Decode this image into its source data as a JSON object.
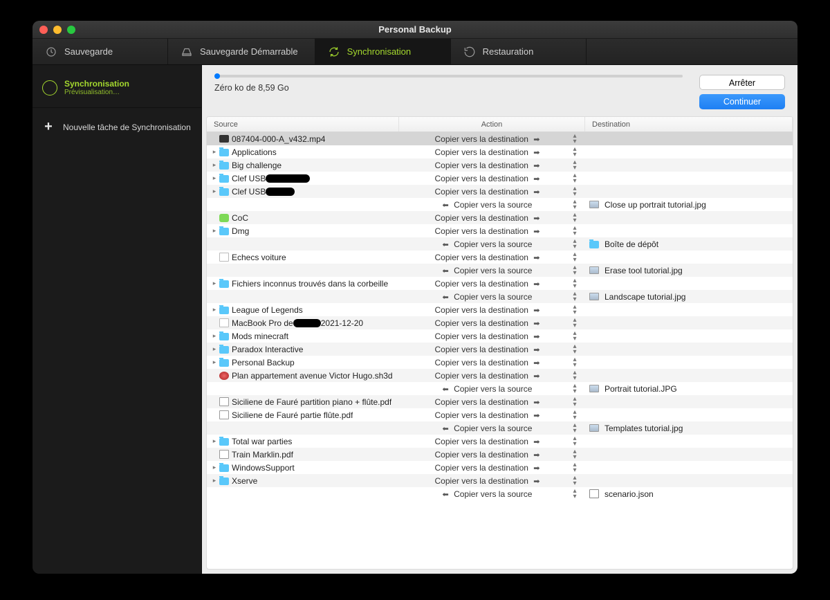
{
  "window_title": "Personal Backup",
  "tabs": [
    {
      "label": "Sauvegarde",
      "icon": "sync"
    },
    {
      "label": "Sauvegarde Démarrable",
      "icon": "drive"
    },
    {
      "label": "Synchronisation",
      "icon": "refresh",
      "active": true
    },
    {
      "label": "Restauration",
      "icon": "restore"
    }
  ],
  "sidebar": {
    "task_title": "Synchronisation",
    "task_sub": "Prévisualisation…",
    "new_task": "Nouvelle tâche de Synchronisation"
  },
  "progress_text": "Zéro ko de 8,59 Go",
  "buttons": {
    "stop": "Arrêter",
    "continue": "Continuer"
  },
  "columns": {
    "source": "Source",
    "action": "Action",
    "destination": "Destination"
  },
  "actions": {
    "to_dest": "Copier vers la destination",
    "to_src": "Copier vers la source"
  },
  "rows": [
    {
      "sel": true,
      "src": "087404-000-A_v432.mp4",
      "icon": "video",
      "exp": false,
      "dir": "dest"
    },
    {
      "src": "Applications",
      "icon": "folder",
      "exp": true,
      "dir": "dest"
    },
    {
      "src": "Big challenge",
      "icon": "folder",
      "exp": true,
      "dir": "dest"
    },
    {
      "src": "Clef USB",
      "icon": "folder",
      "exp": true,
      "dir": "dest",
      "redact": 64
    },
    {
      "src": "Clef USB",
      "icon": "folder",
      "exp": true,
      "dir": "dest",
      "redact": 42
    },
    {
      "dir": "src",
      "dst": "Close up portrait tutorial.jpg",
      "dsticon": "img"
    },
    {
      "src": "CoC",
      "icon": "app",
      "exp": false,
      "dir": "dest"
    },
    {
      "src": "Dmg",
      "icon": "folder",
      "exp": true,
      "dir": "dest"
    },
    {
      "dir": "src",
      "dst": "Boîte de dépôt",
      "dsticon": "folder"
    },
    {
      "src": "Echecs voiture",
      "icon": "file",
      "exp": false,
      "dir": "dest"
    },
    {
      "dir": "src",
      "dst": "Erase tool tutorial.jpg",
      "dsticon": "img"
    },
    {
      "src": "Fichiers inconnus trouvés dans la corbeille",
      "icon": "folder",
      "exp": true,
      "dir": "dest"
    },
    {
      "dir": "src",
      "dst": "Landscape tutorial.jpg",
      "dsticon": "img"
    },
    {
      "src": "League of Legends",
      "icon": "folder",
      "exp": true,
      "dir": "dest"
    },
    {
      "src": "MacBook Pro de",
      "src_suffix": "2021-12-20",
      "icon": "file",
      "exp": false,
      "dir": "dest",
      "redact": 40
    },
    {
      "src": "Mods minecraft",
      "icon": "folder",
      "exp": true,
      "dir": "dest"
    },
    {
      "src": "Paradox Interactive",
      "icon": "folder",
      "exp": true,
      "dir": "dest"
    },
    {
      "src": "Personal Backup",
      "icon": "folder",
      "exp": true,
      "dir": "dest"
    },
    {
      "src": "Plan appartement avenue Victor Hugo.sh3d",
      "icon": "sh3d",
      "exp": false,
      "dir": "dest"
    },
    {
      "dir": "src",
      "dst": "Portrait tutorial.JPG",
      "dsticon": "img"
    },
    {
      "src": "Siciliene de Fauré partition piano + flûte.pdf",
      "icon": "pdf",
      "exp": false,
      "dir": "dest"
    },
    {
      "src": "Siciliene de Fauré partie flûte.pdf",
      "icon": "pdf",
      "exp": false,
      "dir": "dest"
    },
    {
      "dir": "src",
      "dst": "Templates tutorial.jpg",
      "dsticon": "img"
    },
    {
      "src": "Total war parties",
      "icon": "folder",
      "exp": true,
      "dir": "dest"
    },
    {
      "src": "Train Marklin.pdf",
      "icon": "pdf",
      "exp": false,
      "dir": "dest"
    },
    {
      "src": "WindowsSupport",
      "icon": "folder",
      "exp": true,
      "dir": "dest"
    },
    {
      "src": "Xserve",
      "icon": "folder",
      "exp": true,
      "dir": "dest"
    },
    {
      "dir": "src",
      "dst": "scenario.json",
      "dsticon": "json"
    }
  ]
}
